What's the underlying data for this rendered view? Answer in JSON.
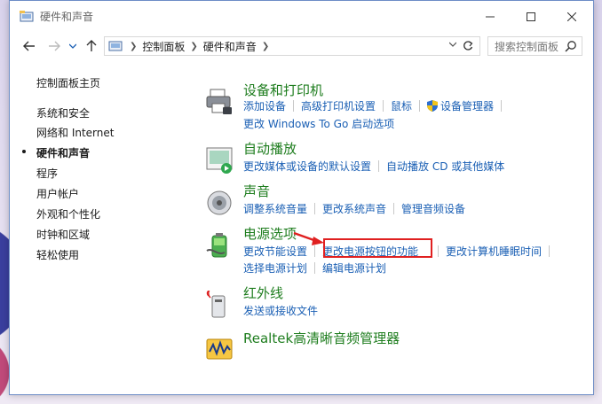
{
  "window": {
    "title": "硬件和声音"
  },
  "address": {
    "crumbs": [
      "控制面板",
      "硬件和声音"
    ]
  },
  "search": {
    "placeholder": "搜索控制面板"
  },
  "sidebar": {
    "items": [
      {
        "label": "控制面板主页",
        "active": false
      },
      {
        "label": "系统和安全",
        "active": false
      },
      {
        "label": "网络和 Internet",
        "active": false
      },
      {
        "label": "硬件和声音",
        "active": true
      },
      {
        "label": "程序",
        "active": false
      },
      {
        "label": "用户帐户",
        "active": false
      },
      {
        "label": "外观和个性化",
        "active": false
      },
      {
        "label": "时钟和区域",
        "active": false
      },
      {
        "label": "轻松使用",
        "active": false
      }
    ]
  },
  "categories": [
    {
      "title": "设备和打印机",
      "icon": "printer-icon",
      "links": [
        [
          "添加设备",
          "高级打印机设置",
          "鼠标",
          "设备管理器"
        ],
        [
          "更改 Windows To Go 启动选项"
        ]
      ]
    },
    {
      "title": "自动播放",
      "icon": "autoplay-icon",
      "links": [
        [
          "更改媒体或设备的默认设置",
          "自动播放 CD 或其他媒体"
        ]
      ]
    },
    {
      "title": "声音",
      "icon": "speaker-icon",
      "links": [
        [
          "调整系统音量",
          "更改系统声音",
          "管理音频设备"
        ]
      ]
    },
    {
      "title": "电源选项",
      "icon": "battery-icon",
      "links": [
        [
          "更改节能设置",
          "更改电源按钮的功能",
          "更改计算机睡眠时间"
        ],
        [
          "选择电源计划",
          "编辑电源计划"
        ]
      ]
    },
    {
      "title": "红外线",
      "icon": "infrared-icon",
      "links": [
        [
          "发送或接收文件"
        ]
      ]
    },
    {
      "title": "Realtek高清晰音频管理器",
      "icon": "realtek-audio-icon",
      "links": []
    }
  ],
  "colors": {
    "category_title": "#1e7d1e",
    "link": "#1a5fb4",
    "highlight": "#e02020"
  }
}
